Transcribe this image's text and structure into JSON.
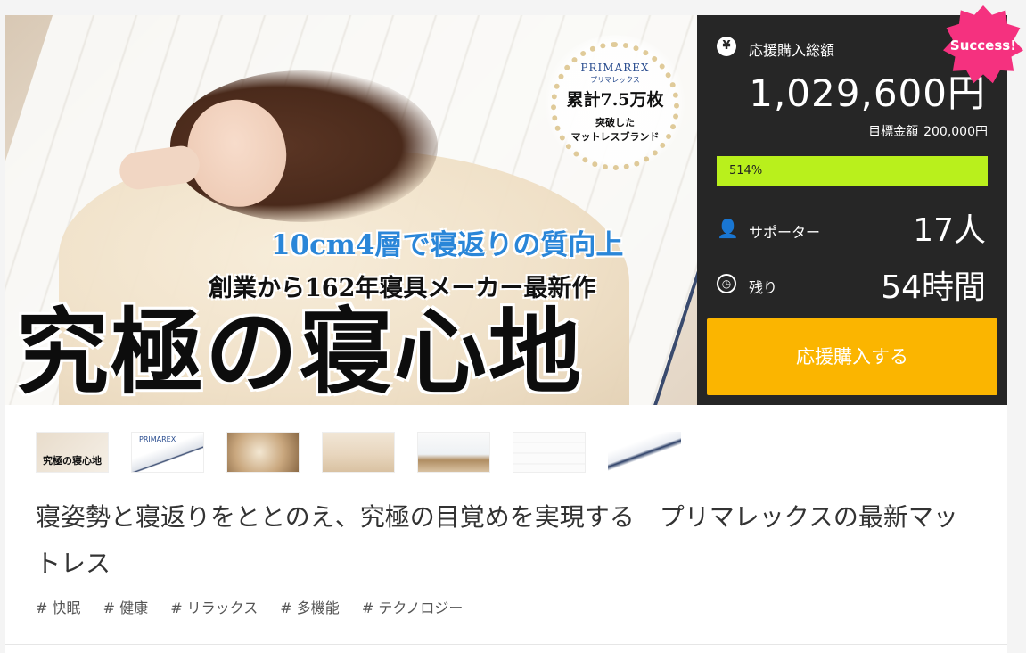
{
  "hero": {
    "badge": {
      "brand": "PRIMAREX",
      "brand_sub": "プリマレックス",
      "count": "累計7.5万枚",
      "line1": "突破した",
      "line2": "マットレスブランド"
    },
    "copy_blue": "10cm4層で寝返りの質向上",
    "copy_black": "創業から162年寝具メーカー最新作",
    "copy_big": "究極の寝心地"
  },
  "panel": {
    "total_label": "応援購入総額",
    "total_amount": "1,029,600円",
    "goal_label": "目標金額",
    "goal_amount": "200,000円",
    "progress_label": "514%",
    "progress_percent": 514,
    "supporters_label": "サポーター",
    "supporters_value": "17人",
    "remaining_label": "残り",
    "remaining_value": "54時間",
    "cta_label": "応援購入する",
    "success_label": "Success!",
    "icons": {
      "total": "yen-icon",
      "supporters": "user-icon",
      "remaining": "clock-icon"
    },
    "colors": {
      "panel_bg": "#262626",
      "progress": "#b9f01c",
      "cta": "#fbb500",
      "success": "#f5317f"
    }
  },
  "thumbnails": [
    {
      "name": "thumb-1",
      "label": "究極の寝心地"
    },
    {
      "name": "thumb-2",
      "label": "PRIMAREX"
    },
    {
      "name": "thumb-3",
      "label": ""
    },
    {
      "name": "thumb-4",
      "label": ""
    },
    {
      "name": "thumb-5",
      "label": ""
    },
    {
      "name": "thumb-6",
      "label": ""
    },
    {
      "name": "thumb-7",
      "label": ""
    }
  ],
  "project": {
    "title": "寝姿勢と寝返りをととのえ、究極の目覚めを実現する　プリマレックスの最新マットレス",
    "tags": [
      "# 快眠",
      "# 健康",
      "# リラックス",
      "# 多機能",
      "# テクノロジー"
    ]
  }
}
